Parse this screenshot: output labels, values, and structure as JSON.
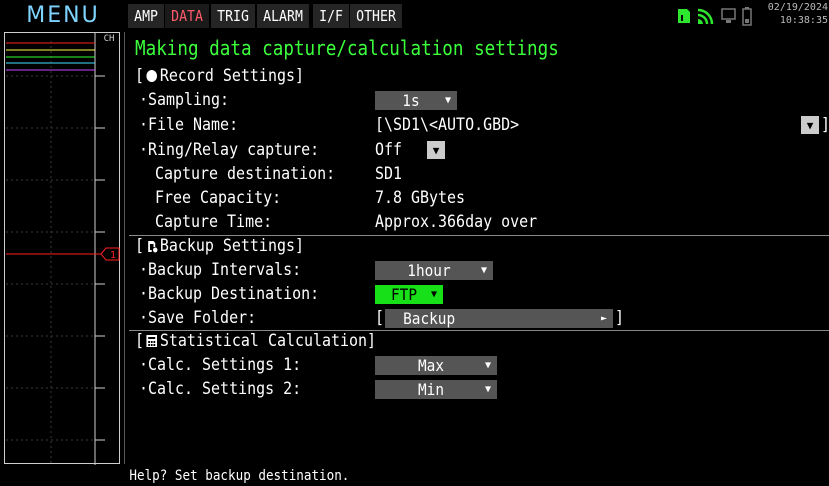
{
  "topbar": {
    "menu_label": "MENU",
    "tabs": [
      {
        "label": "AMP"
      },
      {
        "label": "DATA",
        "active": true
      },
      {
        "label": "TRIG"
      },
      {
        "label": "ALARM"
      },
      {
        "label": "I/F"
      },
      {
        "label": "OTHER"
      }
    ],
    "date": "02/19/2024",
    "time": "10:38:35",
    "status_icons": [
      "sd-card-icon",
      "wifi-icon",
      "network-icon",
      "battery-icon"
    ]
  },
  "wave_panel": {
    "header": "CH",
    "channel_marker": "1",
    "colors": {
      "red": "#ff2020",
      "yellow": "#ffff40",
      "green": "#30ff30",
      "cyan": "#40e0ff",
      "purple": "#cc44ff"
    }
  },
  "main": {
    "title": "Making data capture/calculation settings",
    "record": {
      "header": "Record Settings]",
      "sampling_label": "·Sampling:",
      "sampling_value": "1s",
      "filename_label": "·File Name:",
      "filename_value": "[\\SD1\\<AUTO.GBD>",
      "filename_end": "]",
      "ring_label": "·Ring/Relay capture:",
      "ring_value": "Off",
      "dest_label": "Capture destination:",
      "dest_value": "SD1",
      "free_label": "Free Capacity:",
      "free_value": "7.8 GBytes",
      "time_label": "Capture Time:",
      "time_value": "Approx.366day over"
    },
    "backup": {
      "header": "Backup Settings]",
      "intervals_label": "·Backup Intervals:",
      "intervals_value": "1hour",
      "destination_label": "·Backup Destination:",
      "destination_value": "FTP",
      "folder_label": "·Save Folder:",
      "folder_open": "[",
      "folder_value": "Backup",
      "folder_close": "]"
    },
    "stats": {
      "header": "Statistical Calculation]",
      "calc1_label": "·Calc. Settings 1:",
      "calc1_value": "Max",
      "calc2_label": "·Calc. Settings 2:",
      "calc2_value": "Min"
    },
    "open_bracket": "["
  },
  "help": {
    "text": "Help?  Set backup destination."
  }
}
